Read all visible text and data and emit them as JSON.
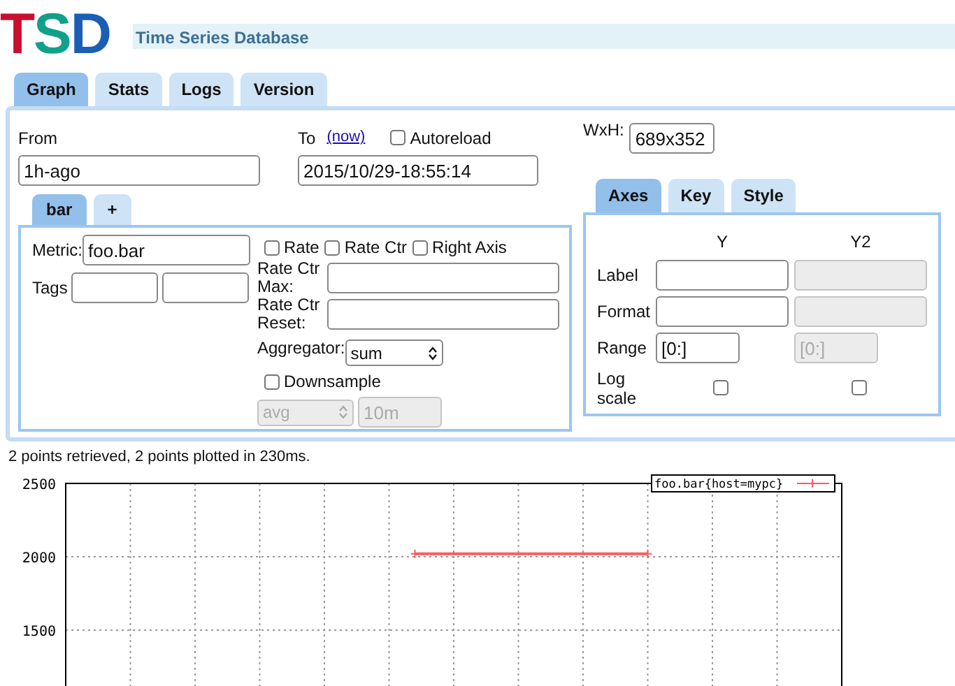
{
  "logo": {
    "letters": [
      {
        "text": "T",
        "color": "#c8102e"
      },
      {
        "text": "S",
        "color": "#12a08a"
      },
      {
        "text": "D",
        "color": "#1a5fb4"
      }
    ]
  },
  "title": "Time Series Database",
  "tabs": [
    {
      "label": "Graph",
      "selected": true
    },
    {
      "label": "Stats",
      "selected": false
    },
    {
      "label": "Logs",
      "selected": false
    },
    {
      "label": "Version",
      "selected": false
    }
  ],
  "time": {
    "from_label": "From",
    "from_value": "1h-ago",
    "to_label": "To",
    "now_link": "(now)",
    "to_value": "2015/10/29-18:55:14",
    "autoreload": {
      "label": "Autoreload",
      "checked": false
    }
  },
  "size": {
    "label": "WxH:",
    "value": "689x352"
  },
  "query_tabs": [
    {
      "label": "bar",
      "selected": true
    },
    {
      "label": "+",
      "selected": false
    }
  ],
  "query": {
    "metric_label": "Metric:",
    "metric_value": "foo.bar",
    "tags_label": "Tags",
    "options": [
      {
        "label": "Rate",
        "checked": false
      },
      {
        "label": "Rate Ctr",
        "checked": false
      },
      {
        "label": "Right Axis",
        "checked": false
      }
    ],
    "rate_ctr_max_label": "Rate Ctr Max:",
    "rate_ctr_reset_label": "Rate Ctr Reset:",
    "aggregator_label": "Aggregator:",
    "aggregator_value": "sum",
    "downsample": {
      "label": "Downsample",
      "checked": false,
      "function": "avg",
      "interval": "10m",
      "disabled": true
    }
  },
  "axes_tabs": [
    {
      "label": "Axes",
      "selected": true
    },
    {
      "label": "Key",
      "selected": false
    },
    {
      "label": "Style",
      "selected": false
    }
  ],
  "axes": {
    "columns": [
      "Y",
      "Y2"
    ],
    "rows": [
      {
        "label": "Label",
        "kind": "text",
        "fields": [
          {
            "disabled": false
          },
          {
            "disabled": true
          }
        ]
      },
      {
        "label": "Format",
        "kind": "text",
        "fields": [
          {
            "disabled": false
          },
          {
            "disabled": true
          }
        ]
      },
      {
        "label": "Range",
        "kind": "short",
        "fields": [
          {
            "value": "[0:]",
            "disabled": false
          },
          {
            "value": "[0:]",
            "disabled": true
          }
        ]
      },
      {
        "label": "Log scale",
        "kind": "checkbox",
        "fields": [
          {
            "checked": false
          },
          {
            "checked": false
          }
        ]
      }
    ]
  },
  "status": "2 points retrieved, 2 points plotted in 230ms.",
  "graph": {
    "chart_data": {
      "type": "line",
      "categories": [
        null,
        null,
        null,
        null,
        null,
        null,
        null,
        null,
        null,
        null
      ],
      "grid": true,
      "ylim": [
        1000,
        2500
      ],
      "yticks": [
        1500,
        2000,
        2500
      ],
      "series": [
        {
          "name": "foo.bar{host=mypc}",
          "color": "#ff5a5a",
          "values": [
            null,
            null,
            null,
            null,
            2020,
            2020,
            2020,
            2020,
            null,
            null
          ]
        }
      ]
    }
  }
}
